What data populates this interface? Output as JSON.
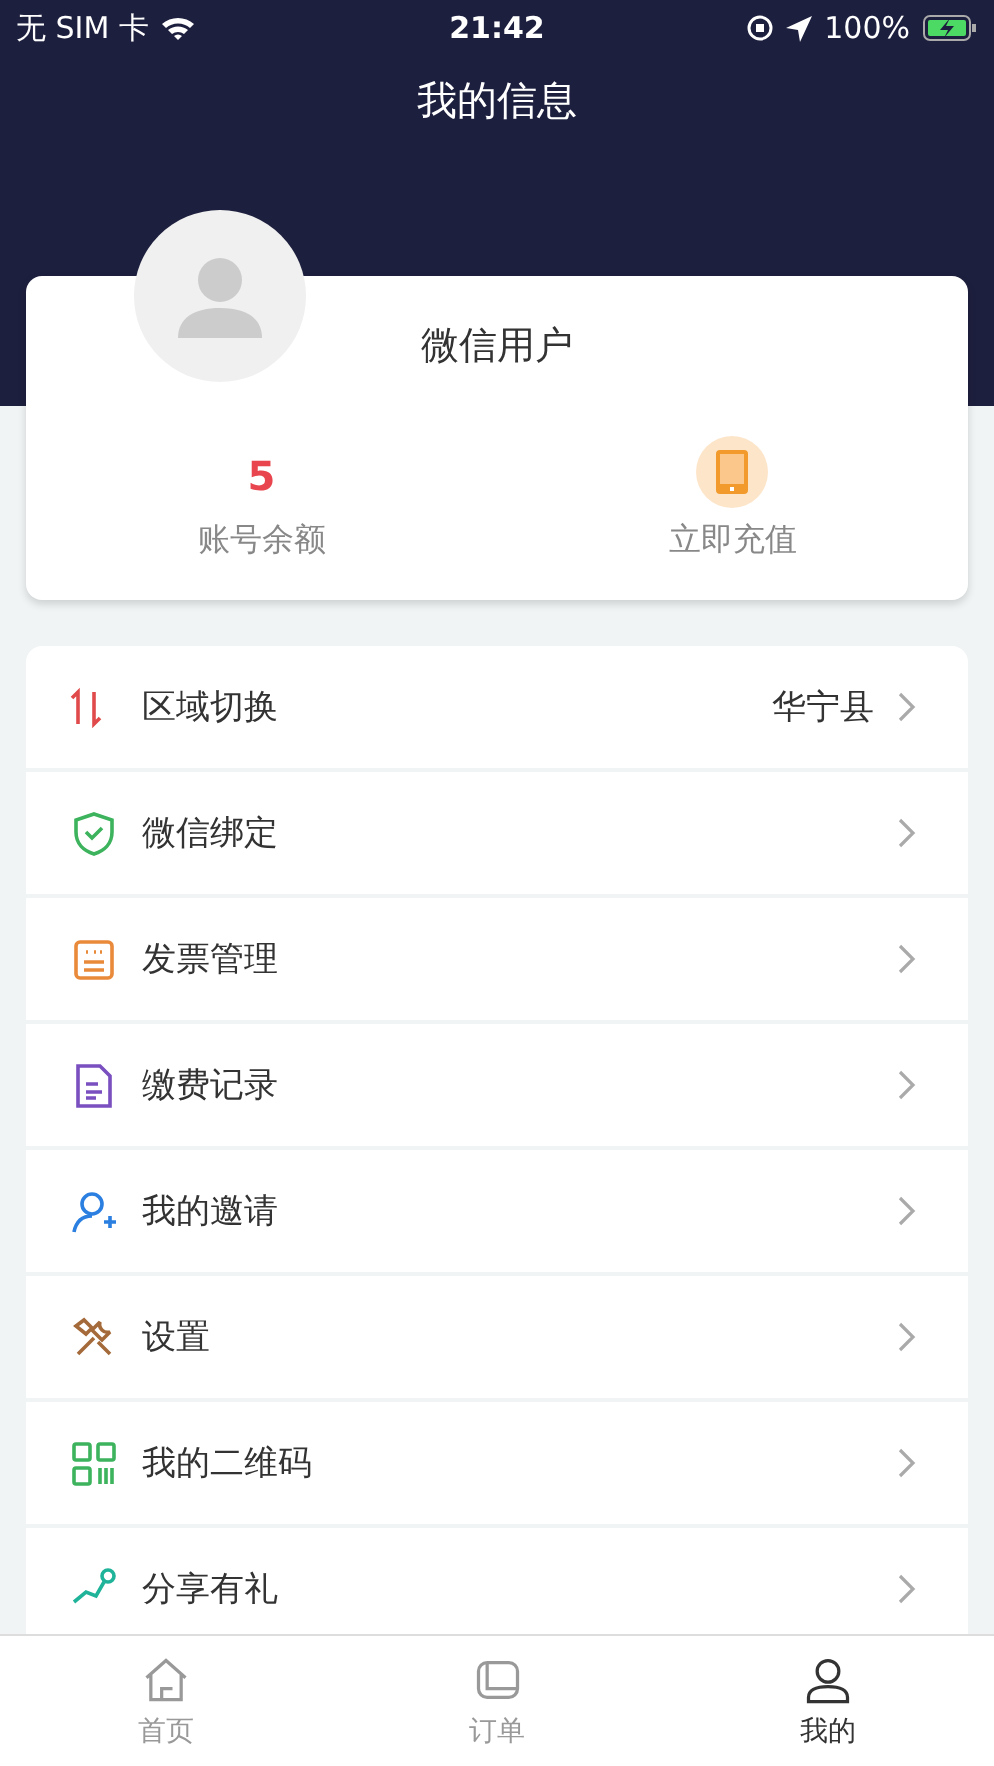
{
  "status_bar": {
    "carrier": "无 SIM 卡",
    "time": "21:42",
    "battery": "100%"
  },
  "title": "我的信息",
  "profile": {
    "name": "微信用户",
    "balance": "5",
    "balance_label": "账号余额",
    "recharge_label": "立即充值"
  },
  "menu": [
    {
      "kind": "region",
      "label": "区域切换",
      "value": "华宁县"
    },
    {
      "kind": "wechat",
      "label": "微信绑定"
    },
    {
      "kind": "invoice",
      "label": "发票管理"
    },
    {
      "kind": "payment",
      "label": "缴费记录"
    },
    {
      "kind": "invite",
      "label": "我的邀请"
    },
    {
      "kind": "settings",
      "label": "设置"
    },
    {
      "kind": "qrcode",
      "label": "我的二维码"
    },
    {
      "kind": "share",
      "label": "分享有礼"
    }
  ],
  "tabs": [
    {
      "kind": "home",
      "label": "首页",
      "selected": false
    },
    {
      "kind": "orders",
      "label": "订单",
      "selected": false
    },
    {
      "kind": "mine",
      "label": "我的",
      "selected": true
    }
  ]
}
